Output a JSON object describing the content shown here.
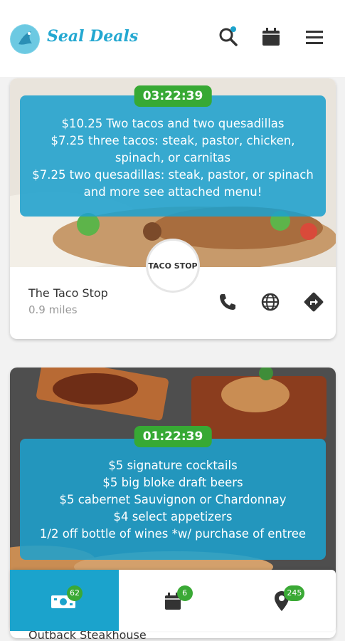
{
  "app": {
    "brand": "Seal Deals"
  },
  "header": {
    "icons": [
      "search-icon",
      "calendar-icon",
      "menu-icon"
    ]
  },
  "deals": [
    {
      "timer": "03:22:39",
      "lines": [
        "$10.25 Two tacos and two quesadillas",
        "$7.25 three tacos: steak, pastor, chicken, spinach, or carnitas",
        "$7.25 two quesadillas: steak, pastor, or spinach and more see attached menu!"
      ],
      "logo_text": "TACO STOP",
      "name": "The Taco Stop",
      "distance": "0.9 miles"
    },
    {
      "timer": "01:22:39",
      "lines": [
        "$5 signature cocktails",
        "$5 big bloke draft beers",
        "$5 cabernet Sauvignon or Chardonnay",
        "$4 select appetizers",
        "1/2 off bottle of wines *w/ purchase of entree"
      ],
      "name": "Outback Steakhouse"
    }
  ],
  "bottom_nav": {
    "tabs": [
      {
        "icon": "cash-icon",
        "badge": "62"
      },
      {
        "icon": "calendar-icon",
        "badge": "6"
      },
      {
        "icon": "map-pin-icon",
        "badge": "245"
      }
    ]
  },
  "colors": {
    "accent": "#1ba3cc",
    "timer": "#37a934"
  }
}
